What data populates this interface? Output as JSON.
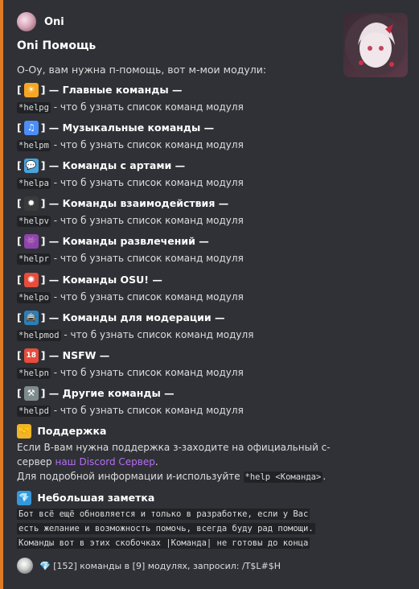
{
  "author": {
    "name": "Oni"
  },
  "title": "Oni Помощь",
  "description": "О-Оу, вам нужна п-помощь, вот м-мои модули:",
  "fields": [
    {
      "emoji": "☀",
      "emoji_bg": "#f5a623",
      "name": "— Главные команды —",
      "command": "*helpg",
      "text": " - что б узнать список команд модуля"
    },
    {
      "emoji": "♫",
      "emoji_bg": "#4c8ef7",
      "name": "— Музыкальные команды —",
      "command": "*helpm",
      "text": " - что б узнать список команд модуля"
    },
    {
      "emoji": "💬",
      "emoji_bg": "#4aa3df",
      "name": "— Команды с артами —",
      "command": "*helpa",
      "text": " - что б узнать список команд модуля"
    },
    {
      "emoji": "✹",
      "emoji_bg": "#3a3a3a",
      "name": "— Команды взаимодействия —",
      "command": "*helpv",
      "text": " - что б узнать список команд модуля"
    },
    {
      "emoji": "👾",
      "emoji_bg": "#8e44ad",
      "name": "— Команды развлечений —",
      "command": "*helpr",
      "text": " - что б узнать список команд модуля"
    },
    {
      "emoji": "✺",
      "emoji_bg": "#e74c3c",
      "name": "— Команды OSU! —",
      "command": "*helpo",
      "text": " - что б узнать список команд модуля"
    },
    {
      "emoji": "🚔",
      "emoji_bg": "#2980b9",
      "name": "— Команды для модерации —",
      "command": "*helpmod",
      "text": " - что б узнать список команд модуля"
    },
    {
      "emoji": "18",
      "emoji_bg": "#e74c3c",
      "name": "— NSFW —",
      "command": "*helpn",
      "text": " - что б узнать список команд модуля"
    },
    {
      "emoji": "⚒",
      "emoji_bg": "#7f8c8d",
      "name": "— Другие команды —",
      "command": "*helpd",
      "text": " - что б узнать список команд модуля"
    }
  ],
  "support": {
    "emoji": "🤝",
    "title": "Поддержка",
    "line1": "Если В-вам нужна поддержка з-заходите на официальный с-",
    "line2_prefix": "сервер ",
    "link": "наш Discord Сервер",
    "line2_suffix": ".",
    "line3_prefix": "Для подробной информации и-используйте ",
    "line3_code": "*help <Команда>",
    "line3_suffix": "."
  },
  "note": {
    "emoji": "💎",
    "title": "Небольшая заметка",
    "lines": [
      "Бот всё ещё обновляется и только в разработке, если у Вас",
      "есть желание и возможность помочь, всегда буду рад помощи.",
      "Команды вот в этих скобочках |Команда| не готовы до конца"
    ]
  },
  "footer": {
    "emoji": "💎",
    "text": "[152] команды в [9] модулях, запросил: /T$L#$H"
  },
  "colors": {
    "accent": "#e07b24",
    "link": "#b86cf6",
    "bg": "#2f3136"
  }
}
